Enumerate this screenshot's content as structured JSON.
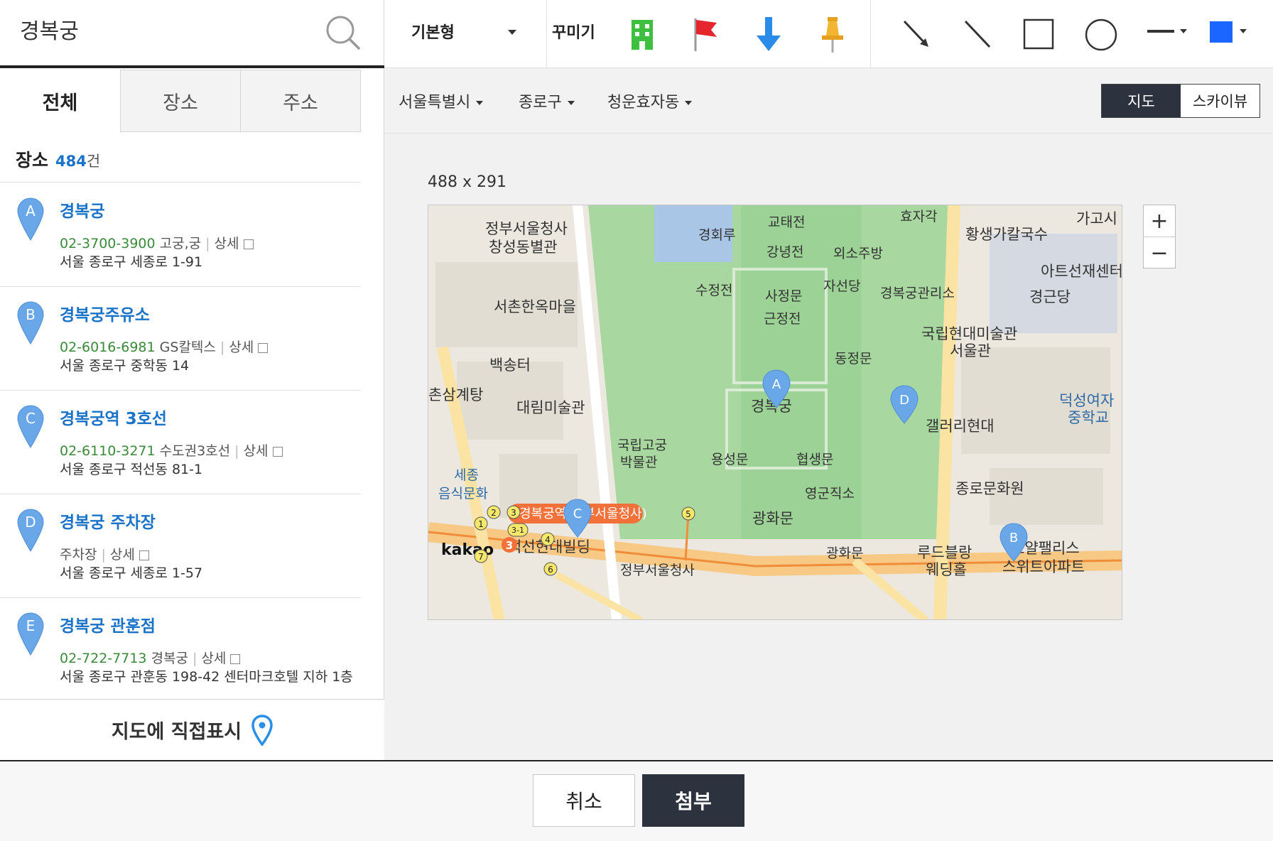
{
  "search": {
    "value": "경복궁"
  },
  "tabs": [
    {
      "label": "전체",
      "active": true
    },
    {
      "label": "장소",
      "active": false
    },
    {
      "label": "주소",
      "active": false
    }
  ],
  "results_summary": {
    "label": "장소",
    "count": "484",
    "unit": "건"
  },
  "results": [
    {
      "marker": "A",
      "name": "경복궁",
      "tel": "02-3700-3900",
      "category": "고궁,궁",
      "detail": "상세",
      "address": "서울 종로구 세종로 1-91"
    },
    {
      "marker": "B",
      "name": "경복궁주유소",
      "tel": "02-6016-6981",
      "category": "GS칼텍스",
      "detail": "상세",
      "address": "서울 종로구 중학동 14"
    },
    {
      "marker": "C",
      "name": "경복궁역 3호선",
      "tel": "02-6110-3271",
      "category": "수도권3호선",
      "detail": "상세",
      "address": "서울 종로구 적선동 81-1"
    },
    {
      "marker": "D",
      "name": "경복궁 주차장",
      "tel": "",
      "category": "주차장",
      "detail": "상세",
      "address": "서울 종로구 세종로 1-57"
    },
    {
      "marker": "E",
      "name": "경복궁 관훈점",
      "tel": "02-722-7713",
      "category": "경복궁",
      "detail": "상세",
      "address": "서울 종로구 관훈동 198-42 센터마크호텔 지하 1층"
    }
  ],
  "direct_mark": {
    "label": "지도에 직접표시"
  },
  "toolbar": {
    "style_select": "기본형",
    "decorate_label": "꾸미기",
    "icons": [
      "building-icon",
      "red-flag-icon",
      "blue-arrow-icon",
      "pushpin-icon",
      "arrow-line-icon",
      "line-icon",
      "rectangle-icon",
      "circle-icon",
      "line-style-icon",
      "color-icon"
    ],
    "accent_color": "#1a66ff"
  },
  "regions": [
    {
      "label": "서울특별시"
    },
    {
      "label": "종로구"
    },
    {
      "label": "청운효자동"
    }
  ],
  "map_type": {
    "map": "지도",
    "skyview": "스카이뷰",
    "selected": "지도"
  },
  "map": {
    "size_label": "488 x 291",
    "logo": "kakao",
    "labels": {
      "gov": "정부서울청사",
      "gov2": "창성동별관",
      "gyeonghoeru": "경회루",
      "gyotaejeon": "교태전",
      "hyojagak": "효자각",
      "hwangsaeng": "황생가칼국수",
      "gagosi": "가고시",
      "gangnyeong": "강녕전",
      "oesojubang": "외소주방",
      "artson": "아트선재센터",
      "sujeongjeon": "수정전",
      "jaseondang": "자선당",
      "sajeongmun": "사정문",
      "office": "경복궁관리소",
      "gyeonggeundang": "경근당",
      "seochon": "서촌한옥마을",
      "geunjeongjeon": "근정전",
      "mmca": "국립현대미술관",
      "mmca2": "서울관",
      "baeksongteo": "백송터",
      "dongjeongmun": "동정문",
      "samgyetang": "촌삼계탕",
      "daelim": "대림미술관",
      "gyeongbokgung": "경복궁",
      "deokseong": "덕성여자",
      "deokseong2": "중학교",
      "gallery": "갤러리현대",
      "palace_museum": "국립고궁",
      "palace_museum2": "박물관",
      "yongseongmun": "용성문",
      "hyeopsaengmun": "협생문",
      "sejong": "세종",
      "sejong2": "음식문화",
      "culture": "종로문화원",
      "yeonggujikso": "영군직소",
      "station": "경복궁역(정부서울청사)",
      "gwanghwamun": "광화문",
      "jeokseon": "적선현대빌딩",
      "gwanghwa_sq": "광화문",
      "rudeblang": "루드블랑",
      "royal": "로얄팰리스",
      "royal2": "스위트아파트",
      "wedding": "웨딩홀",
      "gov_bottom": "정부서울청사"
    },
    "exits": [
      "1",
      "2",
      "3",
      "3-1",
      "4",
      "5",
      "6",
      "7"
    ],
    "station_exit": "3",
    "markers": [
      "A",
      "B",
      "C",
      "D"
    ]
  },
  "buttons": {
    "cancel": "취소",
    "attach": "첨부"
  }
}
